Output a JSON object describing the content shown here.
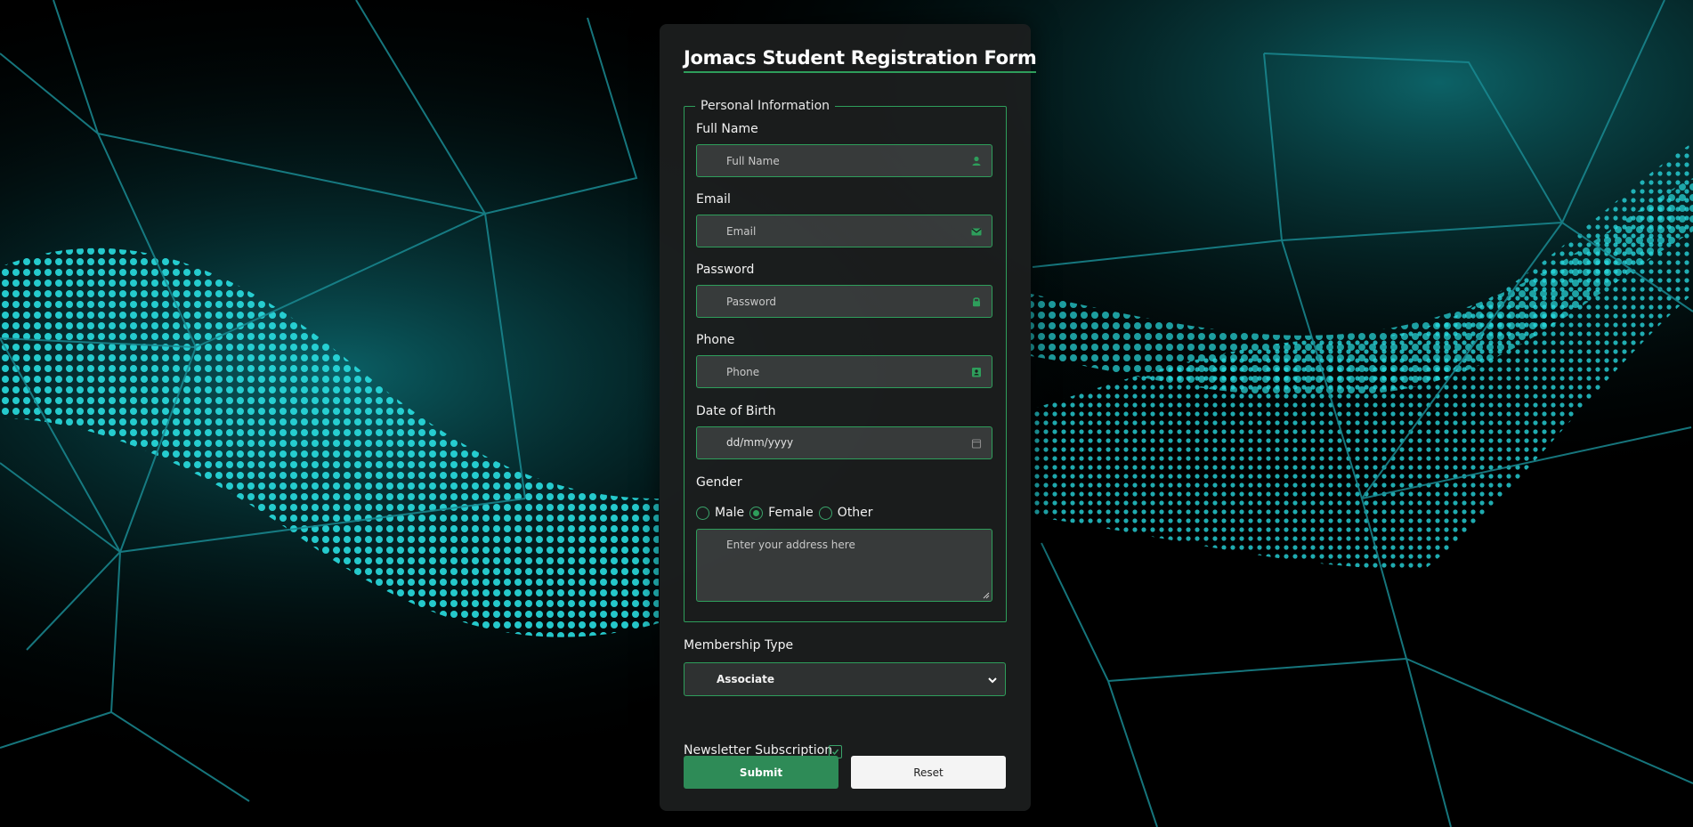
{
  "form": {
    "title": "Jomacs Student Registration Form",
    "fieldset_legend": "Personal Information",
    "full_name": {
      "label": "Full Name",
      "placeholder": "Full Name",
      "icon": "user-icon"
    },
    "email": {
      "label": "Email",
      "placeholder": "Email",
      "icon": "envelope-icon"
    },
    "password": {
      "label": "Password",
      "placeholder": "Password",
      "icon": "lock-icon"
    },
    "phone": {
      "label": "Phone",
      "placeholder": "Phone",
      "icon": "contact-card-icon"
    },
    "dob": {
      "label": "Date of Birth",
      "placeholder": "dd/mm/yyyy",
      "icon": "calendar-icon"
    },
    "gender": {
      "label": "Gender",
      "options": [
        {
          "label": "Male",
          "checked": false
        },
        {
          "label": "Female",
          "checked": true
        },
        {
          "label": "Other",
          "checked": false
        }
      ]
    },
    "address": {
      "placeholder": "Enter your address here"
    },
    "membership": {
      "label": "Membership Type",
      "selected": "Associate"
    },
    "newsletter": {
      "label": "Newsletter Subscription",
      "checked": true
    },
    "buttons": {
      "submit": "Submit",
      "reset": "Reset"
    }
  },
  "colors": {
    "accent": "#2e9e5b",
    "submit_bg": "#2e8b57",
    "card_bg": "#1c1e1e",
    "background_glow": "#1fd4d8"
  }
}
